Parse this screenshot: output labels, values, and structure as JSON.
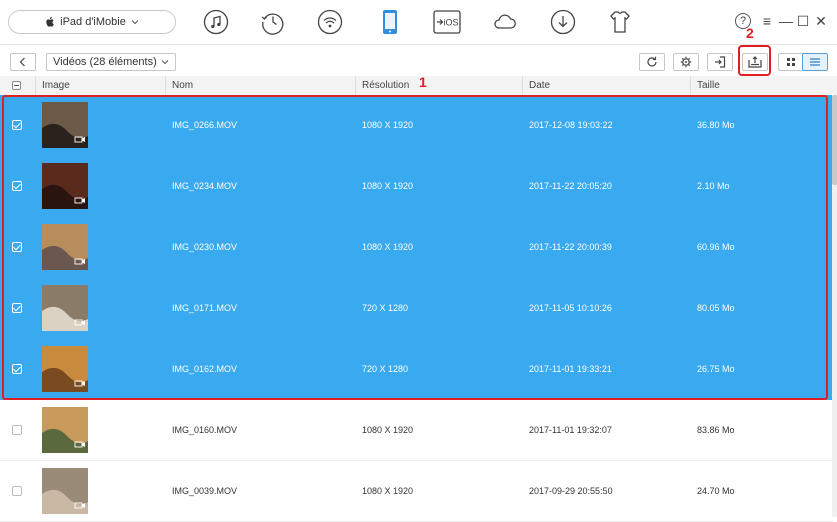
{
  "device": {
    "name": "iPad d'iMobie"
  },
  "top_icons": [
    "music-icon",
    "history-icon",
    "wifi-icon",
    "device-icon",
    "to-ios-icon",
    "cloud-icon",
    "download-icon",
    "tshirt-icon"
  ],
  "to_ios_label": "iOS",
  "window": {
    "help": "?",
    "menu": "≡",
    "minimize": "—",
    "maximize": "☐",
    "close": "✕"
  },
  "category": {
    "label": "Vidéos (28 éléments)"
  },
  "annotations": {
    "one": "1",
    "two": "2"
  },
  "table": {
    "headers": {
      "image": "Image",
      "name": "Nom",
      "resolution": "Résolution",
      "date": "Date",
      "size": "Taille"
    },
    "rows": [
      {
        "name": "IMG_0266.MOV",
        "resolution": "1080 X 1920",
        "date": "2017-12-08 19:03:22",
        "size": "36.80 Mo",
        "selected": true,
        "thumb": [
          "#6b5a48",
          "#2a221c"
        ]
      },
      {
        "name": "IMG_0234.MOV",
        "resolution": "1080 X 1920",
        "date": "2017-11-22 20:05:20",
        "size": "2.10 Mo",
        "selected": true,
        "thumb": [
          "#5a2a1c",
          "#2a1410"
        ]
      },
      {
        "name": "IMG_0230.MOV",
        "resolution": "1080 X 1920",
        "date": "2017-11-22 20:00:39",
        "size": "60.96 Mo",
        "selected": true,
        "thumb": [
          "#b88d5c",
          "#6a5850"
        ]
      },
      {
        "name": "IMG_0171.MOV",
        "resolution": "720 X 1280",
        "date": "2017-11-05 10:10:26",
        "size": "80.05 Mo",
        "selected": true,
        "thumb": [
          "#8a7a68",
          "#dcd2c4"
        ]
      },
      {
        "name": "IMG_0162.MOV",
        "resolution": "720 X 1280",
        "date": "2017-11-01 19:33:21",
        "size": "26.75 Mo",
        "selected": true,
        "thumb": [
          "#c88a3c",
          "#7a4a20"
        ]
      },
      {
        "name": "IMG_0160.MOV",
        "resolution": "1080 X 1920",
        "date": "2017-11-01 19:32:07",
        "size": "83.86 Mo",
        "selected": false,
        "thumb": [
          "#c89a5c",
          "#5a6a3c"
        ]
      },
      {
        "name": "IMG_0039.MOV",
        "resolution": "1080 X 1920",
        "date": "2017-09-29 20:55:50",
        "size": "24.70 Mo",
        "selected": false,
        "thumb": [
          "#9a8a78",
          "#c8b8a4"
        ]
      }
    ]
  },
  "colors": {
    "selection": "#39a9f0",
    "highlight": "#e02020",
    "active_device": "#2f8fe0"
  }
}
